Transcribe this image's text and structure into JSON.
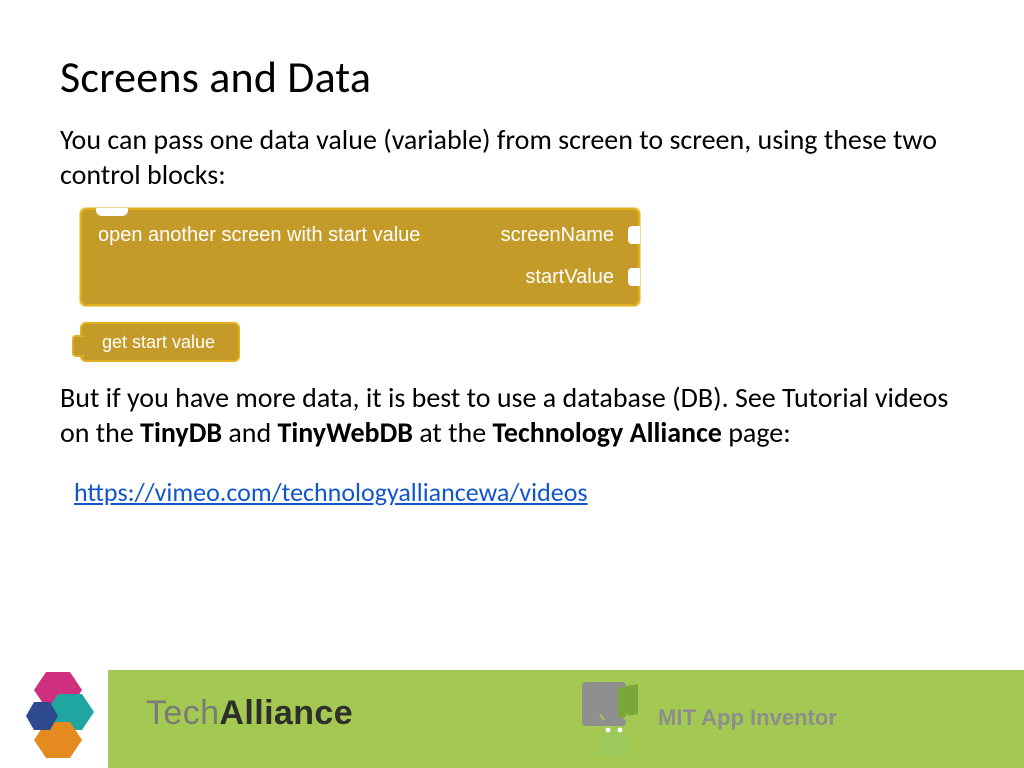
{
  "title": "Screens and Data",
  "para1": "You can pass one data value (variable) from screen to screen, using these two control blocks:",
  "block1": {
    "label": "open another screen with start value",
    "arg1": "screenName",
    "arg2": "startValue"
  },
  "block2": {
    "label": "get start value"
  },
  "para2": {
    "pre": "But if you have more data, it is best to use a database (DB).  See Tutorial videos on the ",
    "b1": "TinyDB",
    "mid1": " and ",
    "b2": "TinyWebDB",
    "mid2": " at the ",
    "b3": "Technology Alliance",
    "post": " page:"
  },
  "link": "https://vimeo.com/technologyalliancewa/videos",
  "footer": {
    "tech": "Tech",
    "alliance": "Alliance",
    "mit": "MIT App Inventor"
  }
}
